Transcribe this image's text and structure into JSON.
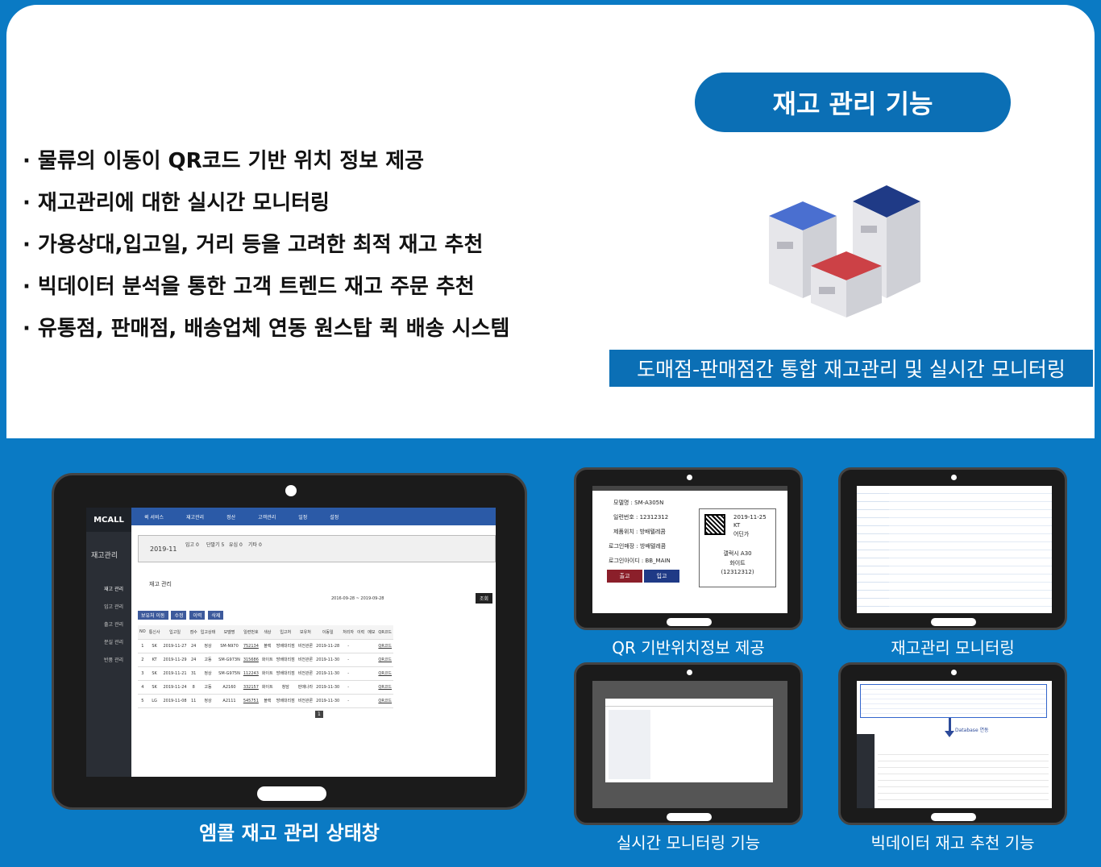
{
  "header_badge": "재고 관리 기능",
  "bullets": [
    "· 물류의 이동이 QR코드 기반 위치 정보 제공",
    "· 재고관리에 대한 실시간 모니터링",
    "· 가용상대,입고일, 거리 등을 고려한 최적 재고  추천",
    "· 빅데이터 분석을 통한 고객 트렌드 재고 주문 추천",
    "· 유통점, 판매점, 배송업체 연동 원스탑 퀵 배송 시스템"
  ],
  "caption_main": "도매점-판매점간 통합 재고관리 및 실시간 모니터링",
  "colors": {
    "blue": "#0a7ac4",
    "dark_blue": "#0b6fb5",
    "cube_blue": "#4a6fd0",
    "cube_navy": "#1f3a86",
    "cube_red": "#cc4146"
  },
  "tablets": {
    "main_caption": "엠콜 재고 관리 상태창",
    "qr_caption": "QR 기반위치정보 제공",
    "monitor_caption": "재고관리 모니터링",
    "realtime_caption": "실시간 모니터링 기능",
    "bigdata_caption": "빅데이터 재고 추천 기능"
  },
  "app": {
    "logo": "MCALL",
    "nav": [
      "퀵 서비스",
      "재고관리",
      "정산",
      "고객관리",
      "일정",
      "설정"
    ],
    "side_title": "재고관리",
    "side_items": [
      "재고 관리",
      "입고 관리",
      "출고 관리",
      "분실 관리",
      "반품 관리"
    ],
    "period": "2019-11",
    "status": [
      "입고 0",
      "단말기 5",
      "유심 0",
      "기타 0"
    ],
    "section_title": "재고 관리",
    "date_range": "2016-09-28 ~ 2019-09-28",
    "search_btn": "조회",
    "actions": [
      "보유처 이동",
      "수정",
      "이력",
      "삭제"
    ],
    "columns": [
      "NO",
      "통신사",
      "입고일",
      "점수",
      "입고상태",
      "모델명",
      "일련번호",
      "색상",
      "입고처",
      "보유처",
      "이동일",
      "처리자",
      "이력",
      "메모",
      "QR코드"
    ],
    "rows": [
      [
        "1",
        "SK",
        "2019-11-27",
        "24",
        "정상",
        "SM-N970",
        "752134",
        "블랙",
        "방배대리점",
        "비전관론",
        "2019-11-28",
        "-",
        "",
        "",
        "QR코드"
      ],
      [
        "2",
        "KT",
        "2019-11-29",
        "24",
        "고동",
        "SM-G973N",
        "315686",
        "화이트",
        "방배대리점",
        "비전관론",
        "2019-11-30",
        "-",
        "",
        "",
        "QR코드"
      ],
      [
        "3",
        "SK",
        "2019-11-21",
        "31",
        "정상",
        "SM-G975N",
        "112243",
        "화이트",
        "방배대리점",
        "비전관론",
        "2019-11-30",
        "-",
        "",
        "",
        "QR코드"
      ],
      [
        "4",
        "SK",
        "2019-11-24",
        "8",
        "고동",
        "A2160",
        "332157",
        "화이트",
        "청담",
        "판매나라",
        "2019-11-30",
        "-",
        "",
        "",
        "QR코드"
      ],
      [
        "5",
        "LG",
        "2019-11-08",
        "11",
        "정상",
        "A2111",
        "545751",
        "블랙",
        "방배대리점",
        "비전관론",
        "2019-11-30",
        "-",
        "",
        "",
        "QR코드"
      ]
    ],
    "page": "1"
  },
  "qr_screen": {
    "model": "모델명 : SM-A305N",
    "serial": "일련번호 : 12312312",
    "location": "제품위치 : 방배텔레콤",
    "login_store": "로그인매장 : 방배텔레콤",
    "login_id": "로그인아이디 : BB_MAIN",
    "btn_out": "출고",
    "btn_in": "입고",
    "tag_date": "2019-11-25",
    "tag_carrier": "KT",
    "tag_store": "어딘가",
    "tag_model": "갤럭시 A30",
    "tag_color": "화이트",
    "tag_serial": "(12312312)"
  },
  "bigdata_screen": {
    "arrow_label": "Database 연동"
  }
}
